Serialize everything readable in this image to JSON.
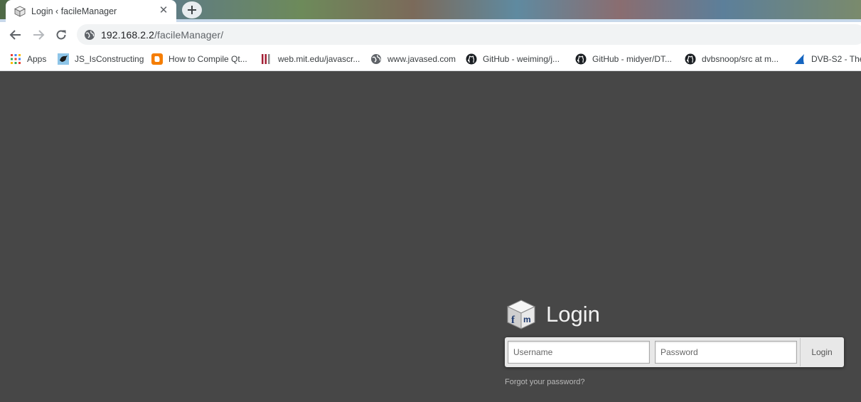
{
  "browser": {
    "tab_title": "Login ‹ facileManager",
    "url_host": "192.168.2.2",
    "url_path": "/facileManager/"
  },
  "bookmarks": [
    {
      "label": "Apps",
      "icon": "apps-grid-icon"
    },
    {
      "label": "JS_IsConstructing",
      "icon": "bird-icon"
    },
    {
      "label": "How to Compile Qt...",
      "icon": "blogger-icon"
    },
    {
      "label": "web.mit.edu/javascr...",
      "icon": "mit-icon"
    },
    {
      "label": "www.javased.com",
      "icon": "globe-icon"
    },
    {
      "label": "GitHub - weiming/j...",
      "icon": "github-icon"
    },
    {
      "label": "GitHub - midyer/DT...",
      "icon": "github-icon"
    },
    {
      "label": "dvbsnoop/src at m...",
      "icon": "github-icon"
    },
    {
      "label": "DVB-S2 - The",
      "icon": "shark-fin-icon"
    }
  ],
  "login": {
    "title": "Login",
    "username_placeholder": "Username",
    "password_placeholder": "Password",
    "button_label": "Login",
    "forgot_link": "Forgot your password?"
  },
  "colors": {
    "page_background": "#474747",
    "title_text": "#f2f2f2"
  }
}
